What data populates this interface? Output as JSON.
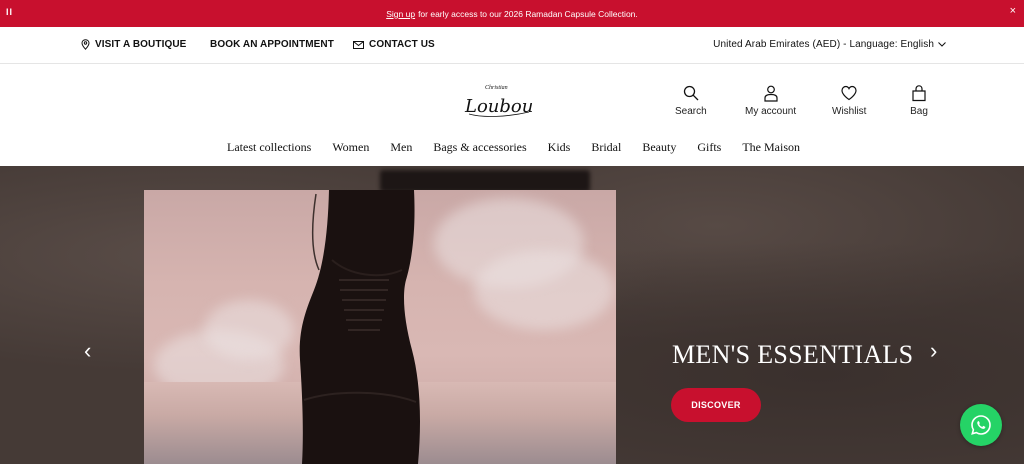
{
  "promo": {
    "pause": "II",
    "link": "Sign up",
    "text": "for early access to our 2026 Ramadan Capsule Collection.",
    "close": "×"
  },
  "utility": {
    "visit": "VISIT A BOUTIQUE",
    "book": "BOOK AN APPOINTMENT",
    "contact": "CONTACT US",
    "locale": "United Arab Emirates (AED) - Language: English"
  },
  "header": {
    "logo_text": "Louboutin",
    "logo_small": "Christian",
    "search": "Search",
    "account": "My account",
    "wishlist": "Wishlist",
    "bag": "Bag"
  },
  "nav": [
    "Latest collections",
    "Women",
    "Men",
    "Bags & accessories",
    "Kids",
    "Bridal",
    "Beauty",
    "Gifts",
    "The Maison"
  ],
  "hero": {
    "title": "MEN'S ESSENTIALS",
    "cta": "DISCOVER",
    "prev": "‹",
    "next": "›"
  },
  "colors": {
    "brand_red": "#c8102e",
    "hero_bg": "#453a36",
    "whatsapp": "#25d366"
  }
}
